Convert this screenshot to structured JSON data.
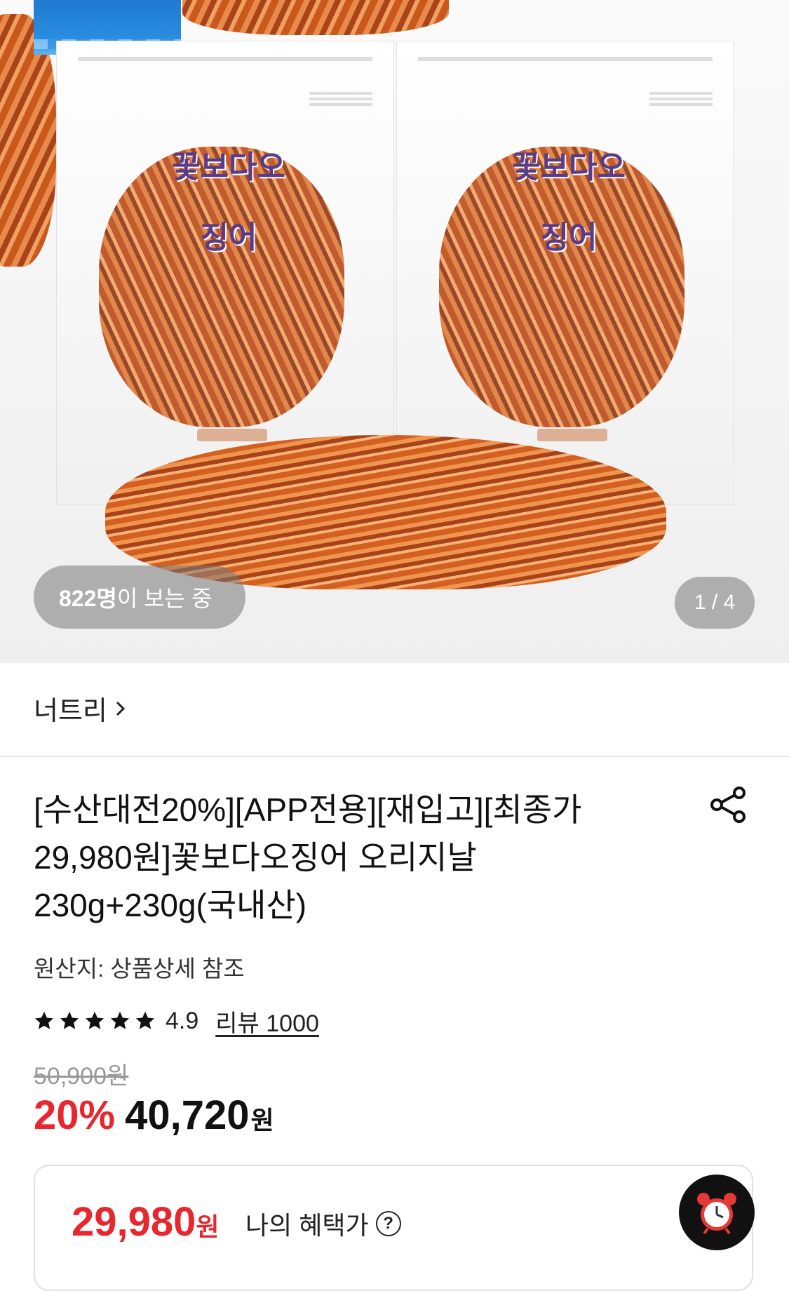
{
  "hero": {
    "viewers_count": "822명",
    "viewers_suffix": "이 보는 중",
    "image_counter": "1 / 4",
    "bag_brand": "꽃보다오징어"
  },
  "store": {
    "name": "너트리",
    "chevron": "›"
  },
  "product": {
    "title": "[수산대전20%][APP전용][재입고][최종가 29,980원]꽃보다오징어 오리지날 230g+230g(국내산)",
    "origin": "원산지: 상품상세 참조",
    "rating": "4.9",
    "review_label": "리뷰 1000",
    "original_price": "50,900원",
    "discount": "20%",
    "price": "40,720",
    "price_unit": "원"
  },
  "benefit": {
    "price": "29,980",
    "price_unit": "원",
    "label": "나의 혜택가",
    "help": "?"
  },
  "colors": {
    "accent": "#e8262e",
    "text": "#111111"
  },
  "icons": [
    "share-icon",
    "star-icon",
    "help-icon",
    "alarm-clock-icon",
    "chevron-right-icon"
  ]
}
